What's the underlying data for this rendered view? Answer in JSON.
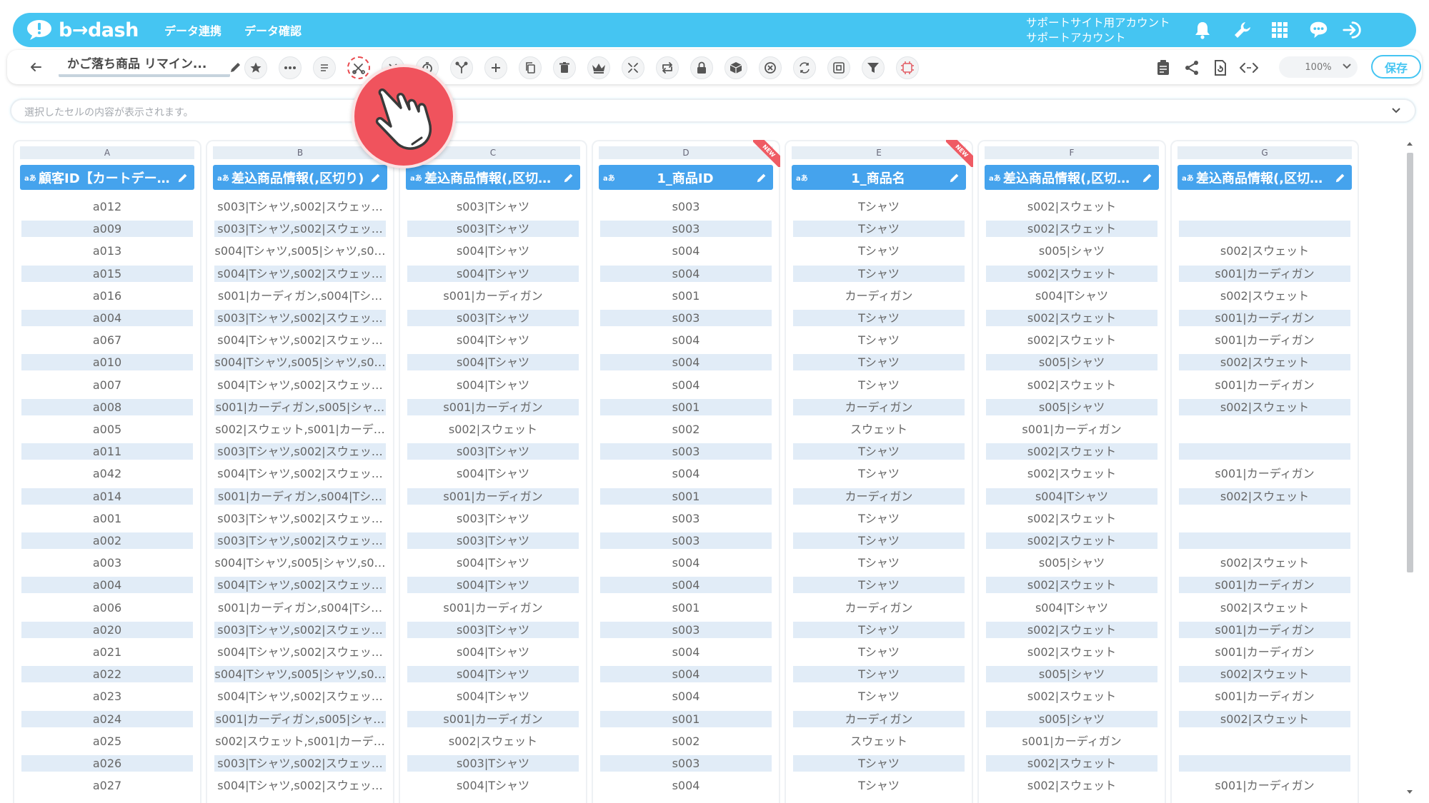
{
  "brand": {
    "name": "b→dash",
    "color": "#45c5f2"
  },
  "nav": [
    {
      "label": "データ連携"
    },
    {
      "label": "データ確認"
    }
  ],
  "account": {
    "line1": "サポートサイト用アカウント",
    "line2": "サポートアカウント"
  },
  "top_icons": [
    "bell-icon",
    "wrench-icon",
    "apps-grid-icon",
    "chat-support-icon",
    "logout-icon"
  ],
  "file": {
    "title": "かご落ち商品 リマイン..."
  },
  "toolbar_icons": [
    "favorite-star-icon",
    "more-icon",
    "memo-icon",
    "split-column-icon",
    "close-column-icon",
    "timer-icon",
    "branch-icon",
    "add-icon",
    "copy-icon",
    "delete-icon",
    "crown-icon",
    "expand-icon",
    "swap-icon",
    "lock-icon",
    "package-icon",
    "clear-icon",
    "replace-icon",
    "frame-icon",
    "filter-icon",
    "ai-icon"
  ],
  "highlighted_tool": "split-column-icon",
  "zoom": {
    "value": "100%"
  },
  "save_label": "保存",
  "formula_bar": {
    "placeholder": "選択したセルの内容が表示されます。"
  },
  "columns": [
    {
      "letter": "A",
      "type": "aあ",
      "name": "顧客ID【カートデー…",
      "is_new": false,
      "cells": [
        "a012",
        "a009",
        "a013",
        "a015",
        "a016",
        "a004",
        "a067",
        "a010",
        "a007",
        "a008",
        "a005",
        "a011",
        "a042",
        "a014",
        "a001",
        "a002",
        "a003",
        "a004",
        "a006",
        "a020",
        "a021",
        "a022",
        "a023",
        "a024",
        "a025",
        "a026",
        "a027"
      ]
    },
    {
      "letter": "B",
      "type": "aあ",
      "name": "差込商品情報(,区切り)",
      "is_new": false,
      "cells": [
        "s003|Tシャツ,s002|スウェッ…",
        "s003|Tシャツ,s002|スウェッ…",
        "s004|Tシャツ,s005|シャツ,s0…",
        "s004|Tシャツ,s002|スウェッ…",
        "s001|カーディガン,s004|Tシ…",
        "s003|Tシャツ,s002|スウェッ…",
        "s004|Tシャツ,s002|スウェッ…",
        "s004|Tシャツ,s005|シャツ,s0…",
        "s004|Tシャツ,s002|スウェッ…",
        "s001|カーディガン,s005|シャ…",
        "s002|スウェット,s001|カーデ…",
        "s003|Tシャツ,s002|スウェッ…",
        "s004|Tシャツ,s002|スウェッ…",
        "s001|カーディガン,s004|Tシ…",
        "s003|Tシャツ,s002|スウェッ…",
        "s003|Tシャツ,s002|スウェッ…",
        "s004|Tシャツ,s005|シャツ,s0…",
        "s004|Tシャツ,s002|スウェッ…",
        "s001|カーディガン,s004|Tシ…",
        "s003|Tシャツ,s002|スウェッ…",
        "s004|Tシャツ,s002|スウェッ…",
        "s004|Tシャツ,s005|シャツ,s0…",
        "s004|Tシャツ,s002|スウェッ…",
        "s001|カーディガン,s005|シャ…",
        "s002|スウェット,s001|カーデ…",
        "s003|Tシャツ,s002|スウェッ…",
        "s004|Tシャツ,s002|スウェッ…"
      ]
    },
    {
      "letter": "C",
      "type": "aあ",
      "name": "差込商品情報(,区切…",
      "is_new": false,
      "cells": [
        "s003|Tシャツ",
        "s003|Tシャツ",
        "s004|Tシャツ",
        "s004|Tシャツ",
        "s001|カーディガン",
        "s003|Tシャツ",
        "s004|Tシャツ",
        "s004|Tシャツ",
        "s004|Tシャツ",
        "s001|カーディガン",
        "s002|スウェット",
        "s003|Tシャツ",
        "s004|Tシャツ",
        "s001|カーディガン",
        "s003|Tシャツ",
        "s003|Tシャツ",
        "s004|Tシャツ",
        "s004|Tシャツ",
        "s001|カーディガン",
        "s003|Tシャツ",
        "s004|Tシャツ",
        "s004|Tシャツ",
        "s004|Tシャツ",
        "s001|カーディガン",
        "s002|スウェット",
        "s003|Tシャツ",
        "s004|Tシャツ"
      ]
    },
    {
      "letter": "D",
      "type": "aあ",
      "name": "1_商品ID",
      "is_new": true,
      "new_label": "NEW",
      "cells": [
        "s003",
        "s003",
        "s004",
        "s004",
        "s001",
        "s003",
        "s004",
        "s004",
        "s004",
        "s001",
        "s002",
        "s003",
        "s004",
        "s001",
        "s003",
        "s003",
        "s004",
        "s004",
        "s001",
        "s003",
        "s004",
        "s004",
        "s004",
        "s001",
        "s002",
        "s003",
        "s004"
      ]
    },
    {
      "letter": "E",
      "type": "aあ",
      "name": "1_商品名",
      "is_new": true,
      "new_label": "NEW",
      "cells": [
        "Tシャツ",
        "Tシャツ",
        "Tシャツ",
        "Tシャツ",
        "カーディガン",
        "Tシャツ",
        "Tシャツ",
        "Tシャツ",
        "Tシャツ",
        "カーディガン",
        "スウェット",
        "Tシャツ",
        "Tシャツ",
        "カーディガン",
        "Tシャツ",
        "Tシャツ",
        "Tシャツ",
        "Tシャツ",
        "カーディガン",
        "Tシャツ",
        "Tシャツ",
        "Tシャツ",
        "Tシャツ",
        "カーディガン",
        "スウェット",
        "Tシャツ",
        "Tシャツ"
      ]
    },
    {
      "letter": "F",
      "type": "aあ",
      "name": "差込商品情報(,区切…",
      "is_new": false,
      "cells": [
        "s002|スウェット",
        "s002|スウェット",
        "s005|シャツ",
        "s002|スウェット",
        "s004|Tシャツ",
        "s002|スウェット",
        "s002|スウェット",
        "s005|シャツ",
        "s002|スウェット",
        "s005|シャツ",
        "s001|カーディガン",
        "s002|スウェット",
        "s002|スウェット",
        "s004|Tシャツ",
        "s002|スウェット",
        "s002|スウェット",
        "s005|シャツ",
        "s002|スウェット",
        "s004|Tシャツ",
        "s002|スウェット",
        "s002|スウェット",
        "s005|シャツ",
        "s002|スウェット",
        "s005|シャツ",
        "s001|カーディガン",
        "s002|スウェット",
        "s002|スウェット"
      ]
    },
    {
      "letter": "G",
      "type": "aあ",
      "name": "差込商品情報(,区切…",
      "is_new": false,
      "cells": [
        "",
        "",
        "s002|スウェット",
        "s001|カーディガン",
        "s002|スウェット",
        "s001|カーディガン",
        "s001|カーディガン",
        "s002|スウェット",
        "s001|カーディガン",
        "s002|スウェット",
        "",
        "",
        "s001|カーディガン",
        "s002|スウェット",
        "",
        "",
        "s002|スウェット",
        "s001|カーディガン",
        "s002|スウェット",
        "s001|カーディガン",
        "s001|カーディガン",
        "s002|スウェット",
        "s001|カーディガン",
        "s002|スウェット",
        "",
        "",
        "s001|カーディガン"
      ]
    }
  ]
}
